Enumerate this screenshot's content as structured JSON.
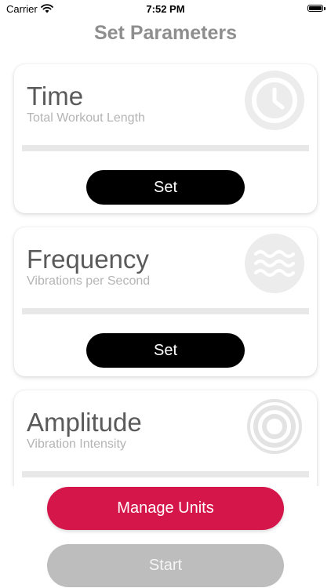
{
  "status_bar": {
    "carrier": "Carrier",
    "time": "7:52 PM"
  },
  "header": {
    "title": "Set Parameters"
  },
  "cards": [
    {
      "title": "Time",
      "subtitle": "Total Workout Length",
      "icon": "clock-icon",
      "button": "Set"
    },
    {
      "title": "Frequency",
      "subtitle": "Vibrations per Second",
      "icon": "waves-icon",
      "button": "Set"
    },
    {
      "title": "Amplitude",
      "subtitle": "Vibration Intensity",
      "icon": "target-rings-icon"
    }
  ],
  "footer": {
    "manage_units": "Manage Units",
    "start": "Start"
  },
  "colors": {
    "manage_button": "#d5164a",
    "start_button": "#bdbdbd",
    "set_button": "#000000",
    "title": "#8e8e8e"
  }
}
